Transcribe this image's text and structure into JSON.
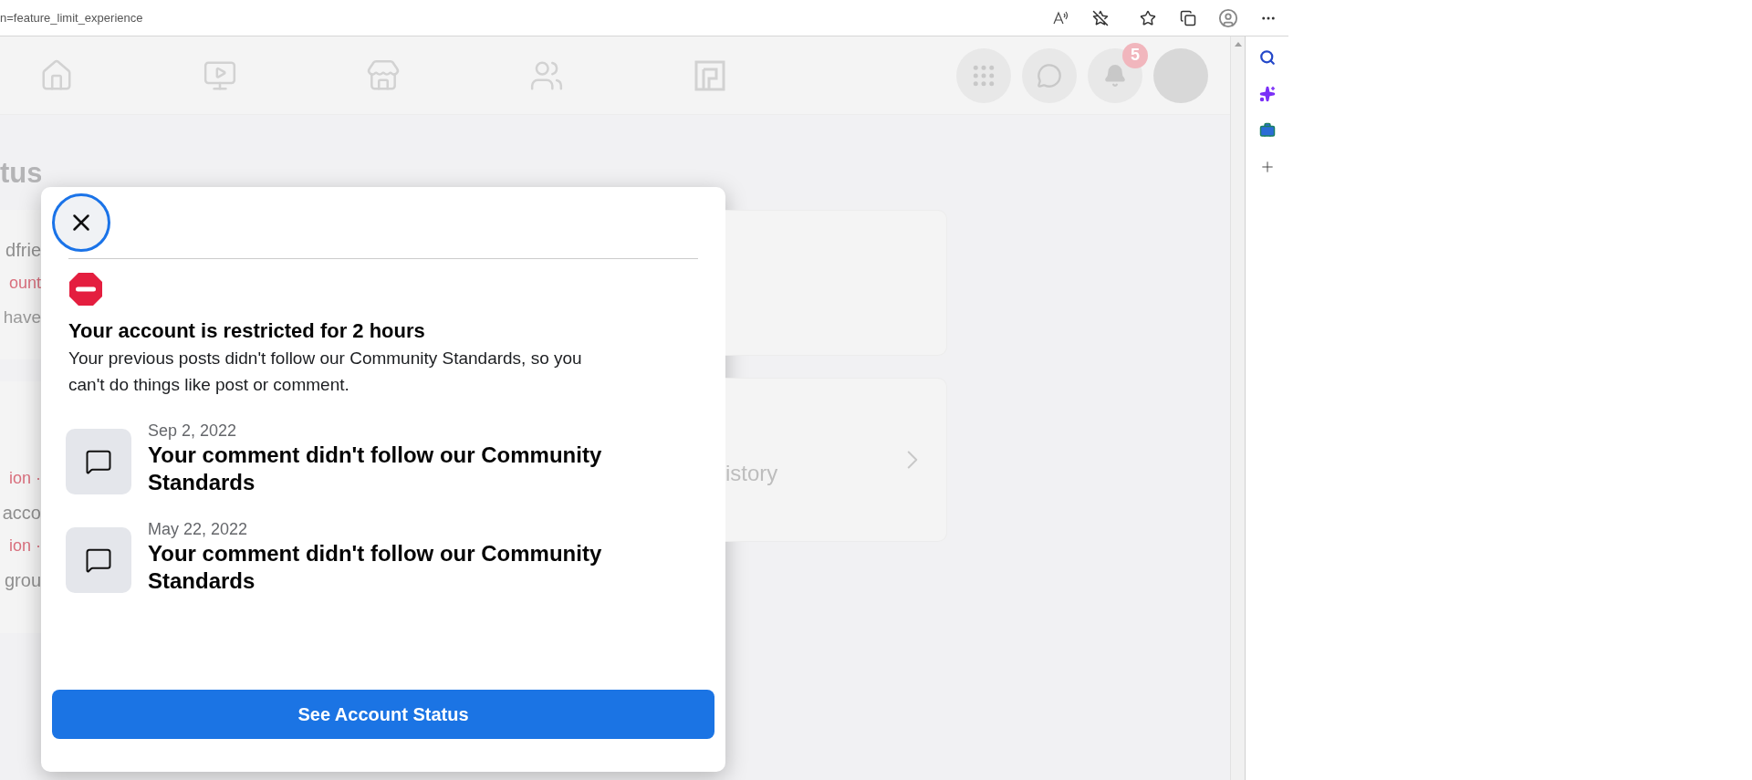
{
  "browser": {
    "address": "n=feature_limit_experience"
  },
  "nav": {
    "notification_badge": "5"
  },
  "background": {
    "heading": "tus",
    "cards": [
      {
        "lines": [
          {
            "text": "dfrie",
            "kind": "name"
          },
          {
            "text": "ount",
            "kind": "status"
          },
          {
            "text": "have",
            "kind": "detail"
          }
        ]
      },
      {
        "lines": [
          {
            "text": "ion ·",
            "kind": "status"
          },
          {
            "text": "acco",
            "kind": "name"
          },
          {
            "text": "ion ·",
            "kind": "status"
          },
          {
            "text": "grou",
            "kind": "name"
          }
        ]
      }
    ],
    "history_label": "istory"
  },
  "dialog": {
    "title": "Your account is restricted for 2 hours",
    "message": "Your previous posts didn't follow our Community Standards, so you can't do things like post or comment.",
    "items": [
      {
        "date": "Sep 2, 2022",
        "text": "Your comment didn't follow our Community Standards"
      },
      {
        "date": "May 22, 2022",
        "text": "Your comment didn't follow our Community Standards"
      }
    ],
    "button": "See Account Status"
  }
}
